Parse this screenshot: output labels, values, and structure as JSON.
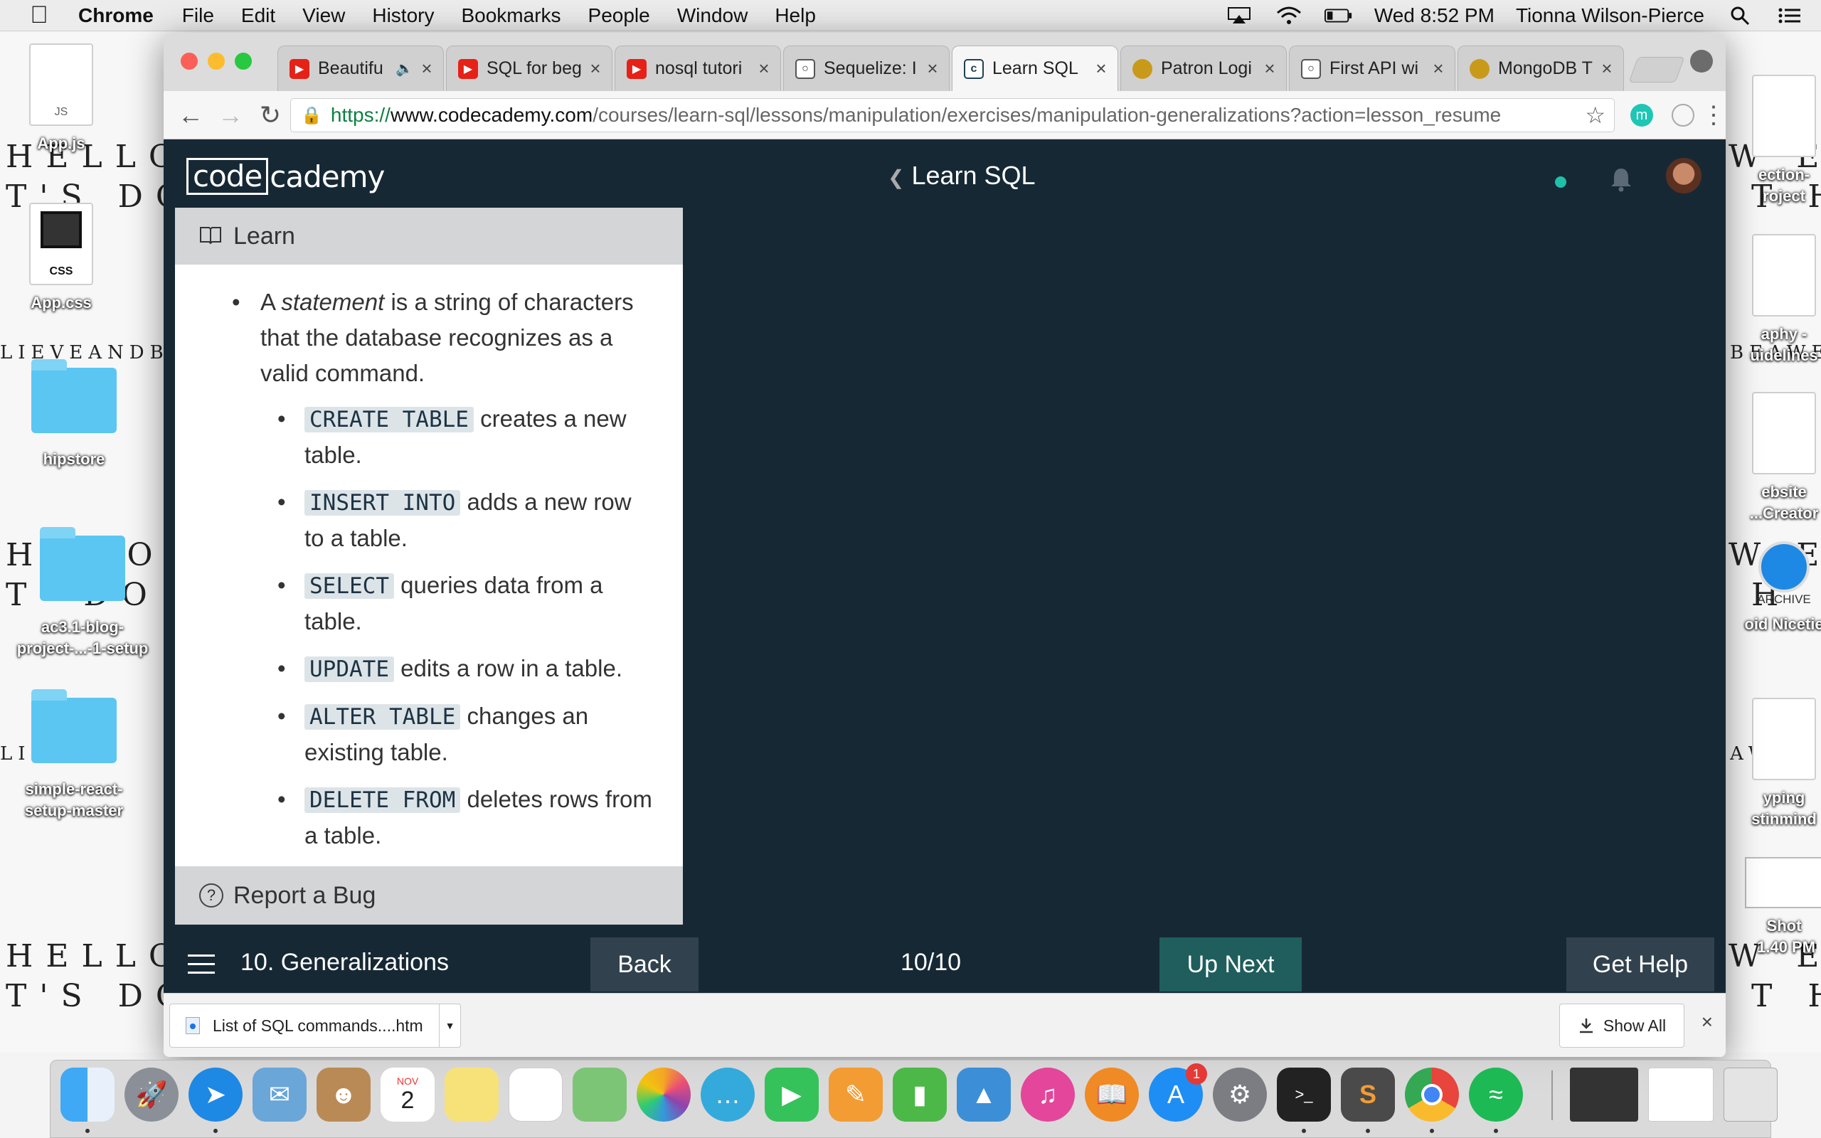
{
  "menubar": {
    "app_name": "Chrome",
    "menus": [
      "File",
      "Edit",
      "View",
      "History",
      "Bookmarks",
      "People",
      "Window",
      "Help"
    ],
    "clock": "Wed 8:52 PM",
    "user": "Tionna Wilson-Pierce"
  },
  "desktop": {
    "poster_left_1": "HELLO,\nT'S DO",
    "poster_left_2": "HE  O,\nT' DO",
    "poster_left_3": "HELLO,\nT'S DO",
    "poster_right_1": "W E\n T H",
    "poster_right_2": "W E\n H",
    "poster_right_3": "W E\n T H",
    "strip_left_1": "LIEVEANDBEA",
    "strip_left_2": "LIE     BEA",
    "strip_right_1": "BEAWES",
    "strip_right_2": "AWES",
    "icons_left": [
      {
        "label": "App.js",
        "ext": "JS"
      },
      {
        "label": "App.css",
        "ext": "CSS"
      },
      {
        "label": "hipstore"
      },
      {
        "label": "ac3.1-blog-\nproject-...-1-setup"
      },
      {
        "label": "simple-react-\nsetup-master"
      }
    ],
    "icons_right": [
      {
        "label": "ection-\nroject"
      },
      {
        "label": "aphy -\nuidelines"
      },
      {
        "label": "ebsite\n...Creator"
      },
      {
        "label": "oid Nicetie",
        "sub": "ARCHIVE"
      },
      {
        "label": "yping\nstinmind"
      },
      {
        "label": "Shot\n 1.40 PM"
      }
    ]
  },
  "tabs": [
    {
      "title": "Beautifu",
      "favicon_color": "#e62117",
      "audio": true
    },
    {
      "title": "SQL for beg",
      "favicon_color": "#e62117"
    },
    {
      "title": "nosql tutori",
      "favicon_color": "#e62117"
    },
    {
      "title": "Sequelize: I",
      "favicon_color": "#555555"
    },
    {
      "title": "Learn SQL",
      "favicon_color": "#1f4056",
      "active": true
    },
    {
      "title": "Patron Logi",
      "favicon_color": "#c99a1a"
    },
    {
      "title": "First API wi",
      "favicon_color": "#555555"
    },
    {
      "title": "MongoDB T",
      "favicon_color": "#c99a1a"
    }
  ],
  "url": {
    "scheme": "https://",
    "host": "www.codecademy.com",
    "path": "/courses/learn-sql/lessons/manipulation/exercises/manipulation-generalizations?action=lesson_resume"
  },
  "codecademy": {
    "logo_box": "code",
    "logo_rest": "cademy",
    "course_title": "Learn SQL",
    "panel_header": "Learn",
    "intro": {
      "pre": "A ",
      "em": "statement",
      "post": " is a string of characters that the database recognizes as a valid command."
    },
    "commands": [
      {
        "code": "CREATE TABLE",
        "text": " creates a new table."
      },
      {
        "code": "INSERT INTO",
        "text": " adds a new row to a table."
      },
      {
        "code": "SELECT",
        "text": " queries data from a table."
      },
      {
        "code": "UPDATE",
        "text": " edits a row in a table."
      },
      {
        "code": "ALTER TABLE",
        "text": " changes an existing table."
      },
      {
        "code": "DELETE FROM",
        "text": " deletes rows from a table."
      }
    ],
    "report_bug": "Report a Bug",
    "lesson_name": "10. Generalizations",
    "back_label": "Back",
    "progress": "10/10",
    "up_next_label": "Up Next",
    "help_label": "Get Help"
  },
  "downloads": {
    "file_name": "List of SQL commands....htm",
    "show_all": "Show All"
  },
  "dock": {
    "calendar_month": "NOV",
    "calendar_day": "2",
    "app_store_badge": "1",
    "apps": [
      {
        "name": "finder",
        "color": "#3a8ee6"
      },
      {
        "name": "launchpad",
        "color": "#8a8f98"
      },
      {
        "name": "safari",
        "color": "#1e88e5"
      },
      {
        "name": "mail",
        "color": "#6aa6d8"
      },
      {
        "name": "contacts",
        "color": "#b98a56"
      },
      {
        "name": "calendar",
        "color": "#ffffff"
      },
      {
        "name": "notes",
        "color": "#f7e27a"
      },
      {
        "name": "reminders",
        "color": "#ffffff"
      },
      {
        "name": "maps",
        "color": "#7cc576"
      },
      {
        "name": "photos",
        "color": "#f5a623"
      },
      {
        "name": "messages",
        "color": "#34aadc"
      },
      {
        "name": "facetime",
        "color": "#36c25a"
      },
      {
        "name": "pages",
        "color": "#f39c34"
      },
      {
        "name": "numbers",
        "color": "#4cb848"
      },
      {
        "name": "keynote",
        "color": "#3c8fd6"
      },
      {
        "name": "itunes",
        "color": "#e3469a"
      },
      {
        "name": "ibooks",
        "color": "#f08a24"
      },
      {
        "name": "app-store",
        "color": "#1e8ef5"
      },
      {
        "name": "system-preferences",
        "color": "#7b7d82"
      },
      {
        "name": "terminal",
        "color": "#222222"
      },
      {
        "name": "sublime-text",
        "color": "#4a4a4a"
      },
      {
        "name": "chrome",
        "color": "#e8453c"
      },
      {
        "name": "spotify",
        "color": "#1db954"
      }
    ]
  }
}
